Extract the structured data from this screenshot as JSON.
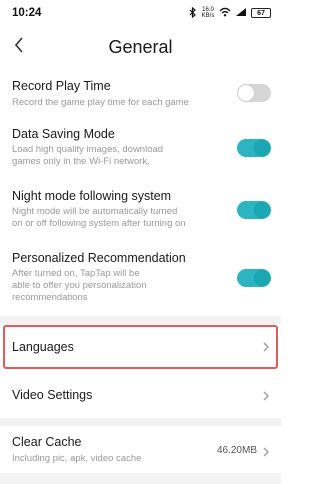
{
  "status_bar": {
    "time": "10:24",
    "icons": [
      "bluetooth-icon",
      "network-speed-icon",
      "wifi-icon",
      "signal-icon",
      "battery-icon"
    ],
    "network_speed": "16.0 KB/s",
    "battery": "67"
  },
  "header": {
    "title": "General",
    "back_icon": "chevron-left-icon"
  },
  "settings": {
    "record_play_time": {
      "title": "Record Play Time",
      "description": "Record the game play time for each game",
      "enabled": false
    },
    "data_saving": {
      "title": "Data Saving Mode",
      "description": "Load high quality images, download\ngames only in the Wi-Fi network.",
      "enabled": true
    },
    "night_mode": {
      "title": "Night mode following system",
      "description": "Night mode will be automatically turned\non or off following system after turning on",
      "enabled": true
    },
    "personalized": {
      "title": "Personalized Recommendation",
      "description": "After turned on, TapTap will be\nable to offer you personalization\nrecommendations",
      "enabled": true
    },
    "languages": {
      "title": "Languages"
    },
    "video_settings": {
      "title": "Video Settings"
    },
    "clear_cache": {
      "title": "Clear Cache",
      "description": "Including pic, apk, video cache",
      "size": "46.20MB"
    }
  },
  "colors": {
    "toggle_on": "#2cb5c0",
    "toggle_off": "#d6d6d6",
    "highlight_border": "#e85a5a",
    "section_band": "#f3f3f3"
  }
}
